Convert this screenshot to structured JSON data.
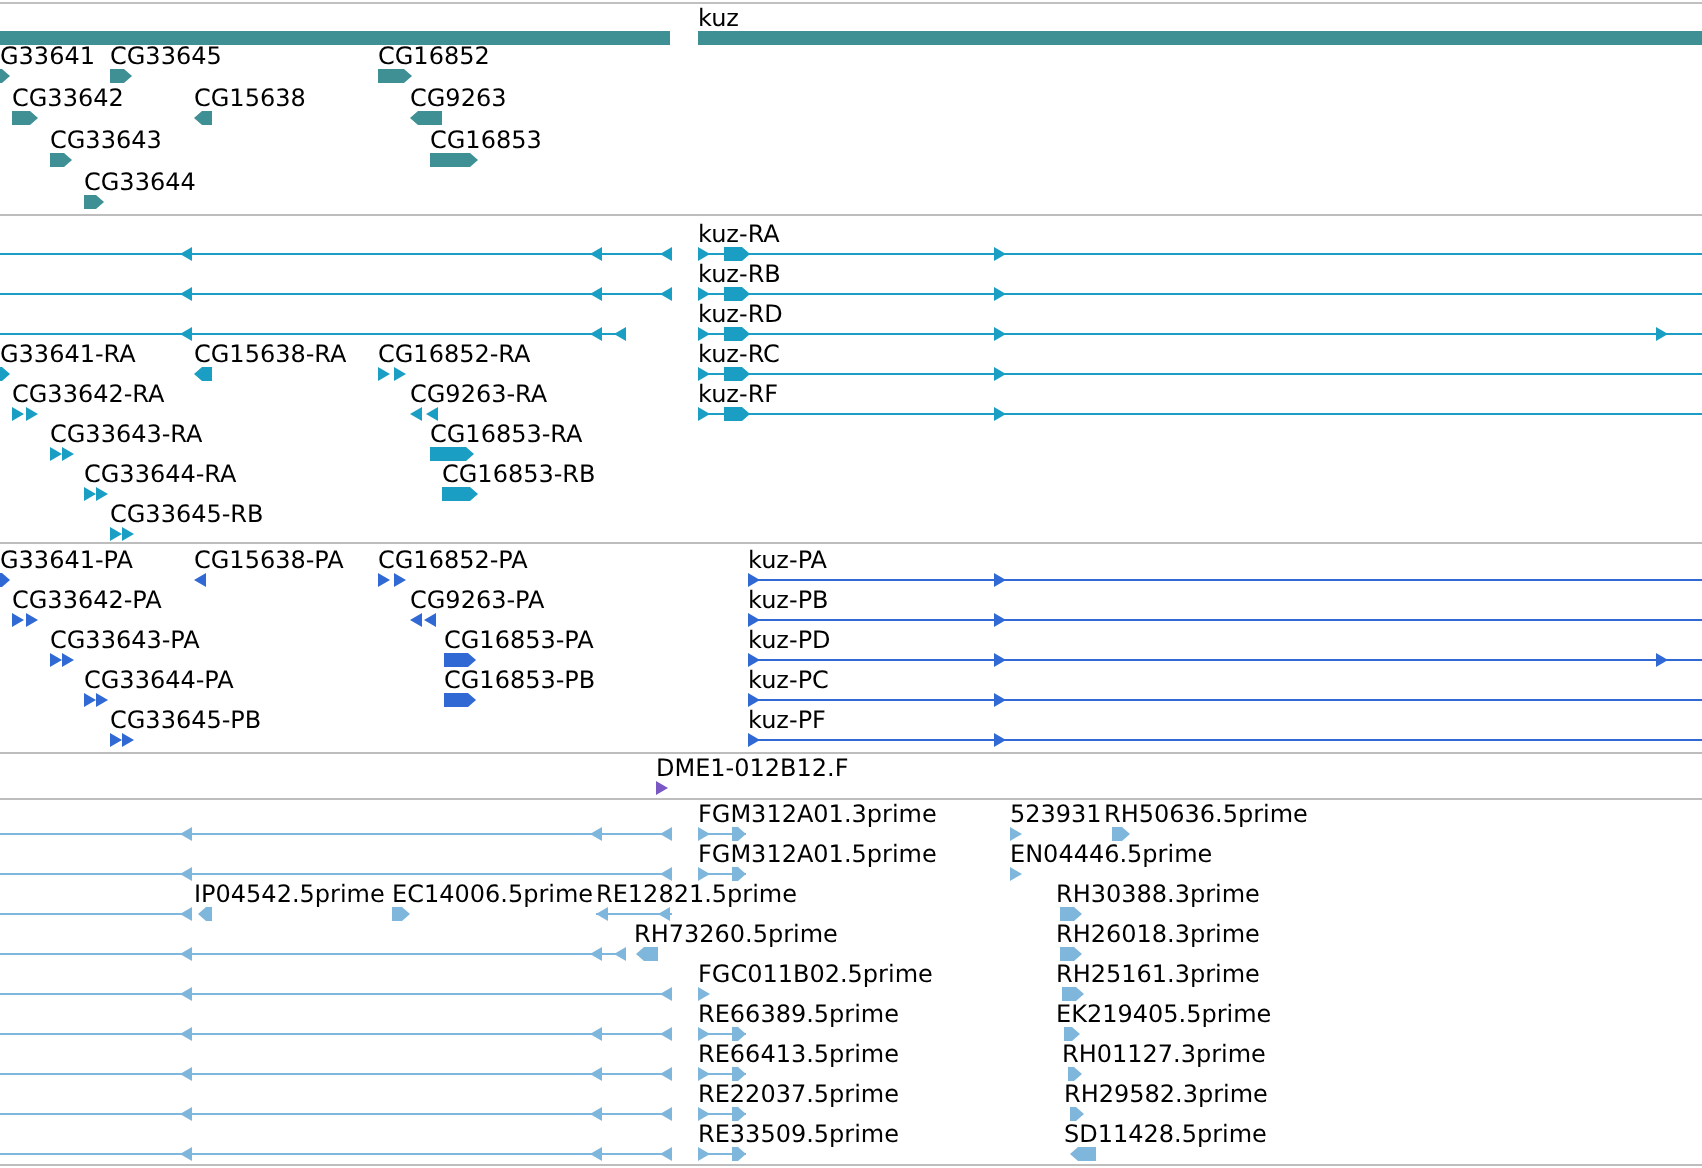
{
  "tracks": [
    {
      "kind": "gene",
      "features": [
        {
          "label": "kuz"
        },
        {
          "label": "G33641",
          "reverse": false
        },
        {
          "label": "CG33645",
          "reverse": false
        },
        {
          "label": "CG16852",
          "reverse": false
        },
        {
          "label": "CG33642",
          "reverse": false
        },
        {
          "label": "CG15638",
          "reverse": true
        },
        {
          "label": "CG9263",
          "reverse": true
        },
        {
          "label": "CG33643",
          "reverse": false
        },
        {
          "label": "CG16853",
          "reverse": false
        },
        {
          "label": "CG33644",
          "reverse": false
        }
      ]
    },
    {
      "kind": "transcript",
      "features": [
        {
          "label": "kuz-RA",
          "reverse": false
        },
        {
          "label": "kuz-RB",
          "reverse": false
        },
        {
          "label": "kuz-RD",
          "reverse": false
        },
        {
          "label": "G33641-RA",
          "reverse": false
        },
        {
          "label": "CG15638-RA",
          "reverse": true
        },
        {
          "label": "CG16852-RA",
          "reverse": false
        },
        {
          "label": "kuz-RC",
          "reverse": false
        },
        {
          "label": "CG33642-RA",
          "reverse": false
        },
        {
          "label": "CG9263-RA",
          "reverse": true
        },
        {
          "label": "kuz-RF",
          "reverse": false
        },
        {
          "label": "CG33643-RA",
          "reverse": false
        },
        {
          "label": "CG16853-RA",
          "reverse": false
        },
        {
          "label": "CG33644-RA",
          "reverse": false
        },
        {
          "label": "CG16853-RB",
          "reverse": false
        },
        {
          "label": "CG33645-RB",
          "reverse": false
        }
      ]
    },
    {
      "kind": "protein",
      "features": [
        {
          "label": "G33641-PA",
          "reverse": false
        },
        {
          "label": "CG15638-PA",
          "reverse": true
        },
        {
          "label": "CG16852-PA",
          "reverse": false
        },
        {
          "label": "kuz-PA",
          "reverse": false
        },
        {
          "label": "CG33642-PA",
          "reverse": false
        },
        {
          "label": "CG9263-PA",
          "reverse": true
        },
        {
          "label": "kuz-PB",
          "reverse": false
        },
        {
          "label": "CG33643-PA",
          "reverse": false
        },
        {
          "label": "CG16853-PA",
          "reverse": false
        },
        {
          "label": "kuz-PD",
          "reverse": false
        },
        {
          "label": "CG33644-PA",
          "reverse": false
        },
        {
          "label": "CG16853-PB",
          "reverse": false
        },
        {
          "label": "kuz-PC",
          "reverse": false
        },
        {
          "label": "CG33645-PB",
          "reverse": false
        },
        {
          "label": "kuz-PF",
          "reverse": false
        }
      ]
    },
    {
      "kind": "clone",
      "features": [
        {
          "label": "DME1-012B12.F",
          "reverse": false
        }
      ]
    },
    {
      "kind": "est",
      "features": [
        {
          "label": "FGM312A01.3prime",
          "reverse": false
        },
        {
          "label": "523931",
          "reverse": false
        },
        {
          "label": "RH50636.5prime",
          "reverse": false
        },
        {
          "label": "FGM312A01.5prime",
          "reverse": false
        },
        {
          "label": "EN04446.5prime",
          "reverse": false
        },
        {
          "label": "IP04542.5prime",
          "reverse": true
        },
        {
          "label": "EC14006.5prime",
          "reverse": false
        },
        {
          "label": "RE12821.5prime",
          "reverse": true
        },
        {
          "label": "RH30388.3prime",
          "reverse": false
        },
        {
          "label": "RH73260.5prime",
          "reverse": true
        },
        {
          "label": "RH26018.3prime",
          "reverse": false
        },
        {
          "label": "FGC011B02.5prime",
          "reverse": false
        },
        {
          "label": "RH25161.3prime",
          "reverse": false
        },
        {
          "label": "RE66389.5prime",
          "reverse": false
        },
        {
          "label": "EK219405.5prime",
          "reverse": false
        },
        {
          "label": "RE66413.5prime",
          "reverse": false
        },
        {
          "label": "RH01127.3prime",
          "reverse": false
        },
        {
          "label": "RE22037.5prime",
          "reverse": false
        },
        {
          "label": "RH29582.3prime",
          "reverse": false
        },
        {
          "label": "RE33509.5prime",
          "reverse": false
        },
        {
          "label": "SD11428.5prime",
          "reverse": true
        }
      ]
    }
  ]
}
